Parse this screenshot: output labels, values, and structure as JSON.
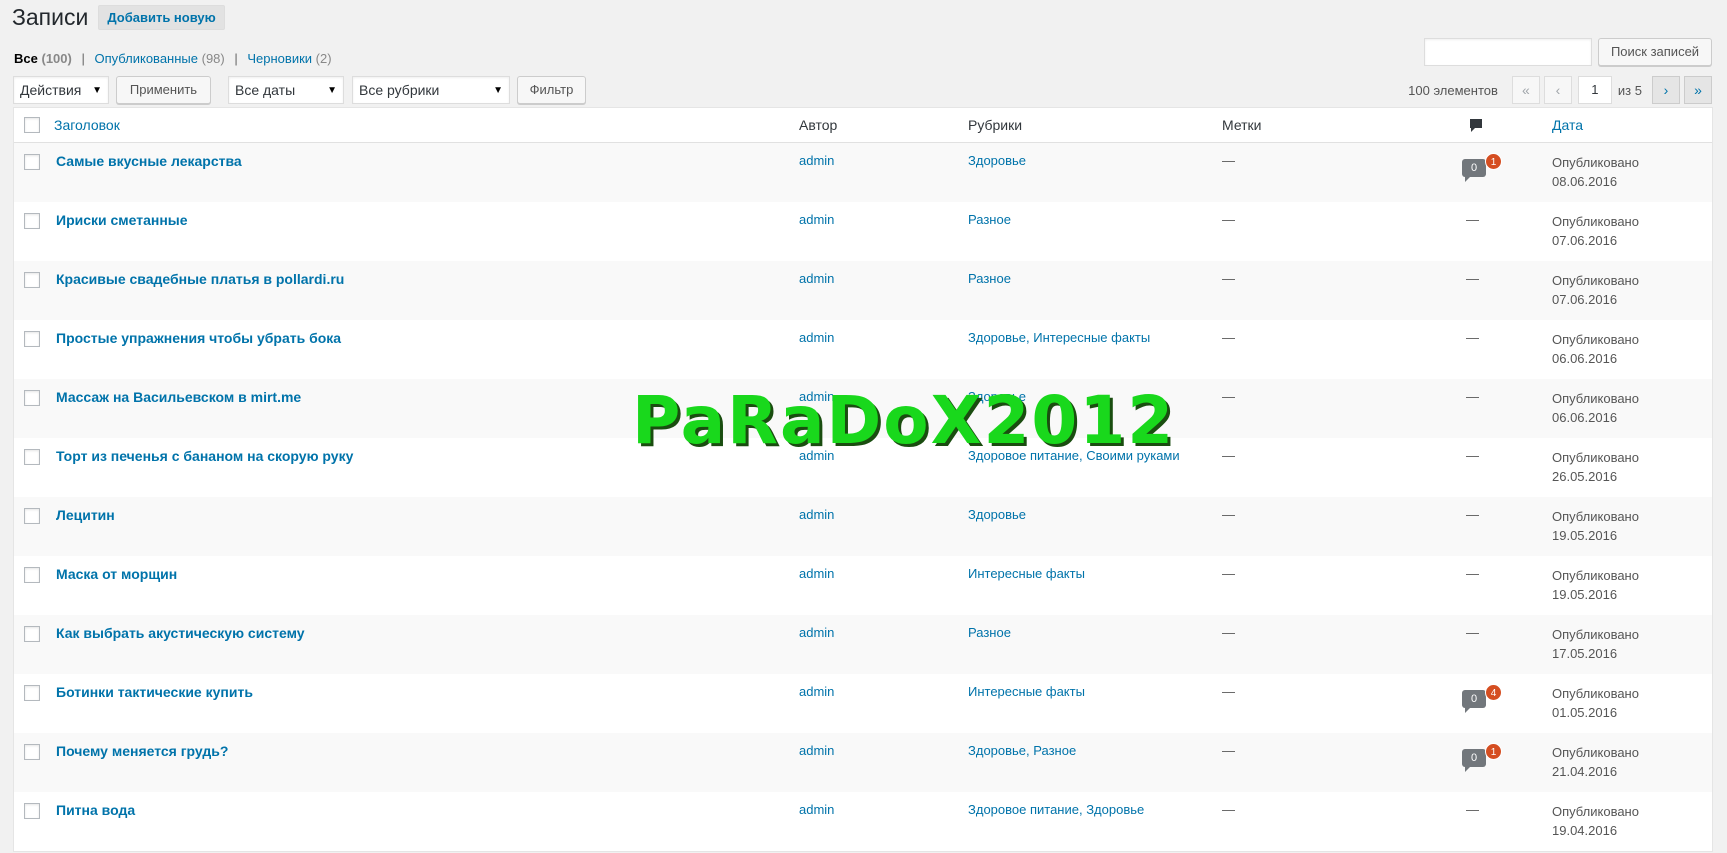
{
  "header": {
    "title": "Записи",
    "add_new": "Добавить новую"
  },
  "views": [
    {
      "label": "Все",
      "count": "(100)"
    },
    {
      "label": "Опубликованные",
      "count": "(98)"
    },
    {
      "label": "Черновики",
      "count": "(2)"
    }
  ],
  "separator": "|",
  "search": {
    "value": "",
    "button": "Поиск записей"
  },
  "tablenav": {
    "bulk_action": "Действия",
    "apply": "Применить",
    "dates": "Все даты",
    "categories": "Все рубрики",
    "filter": "Фильтр",
    "items_count": "100 элементов",
    "first": "«",
    "prev": "‹",
    "current_page": "1",
    "of_pages": "из 5",
    "next": "›",
    "last": "»"
  },
  "columns": {
    "title": "Заголовок",
    "author": "Автор",
    "categories": "Рубрики",
    "tags": "Метки",
    "date": "Дата"
  },
  "icons": {
    "comments_header": "comment-bubble-icon",
    "arrow": "▼"
  },
  "colors": {
    "link": "#0073aa",
    "pending": "#d54e21",
    "bubble": "#72777c",
    "watermark": "#19d81c"
  },
  "rows": [
    {
      "title": "Самые вкусные лекарства",
      "author": "admin",
      "categories": "Здоровье",
      "tags": "—",
      "comments": "0",
      "pending": "1",
      "status": "Опубликовано",
      "date": "08.06.2016"
    },
    {
      "title": "Ириски сметанные",
      "author": "admin",
      "categories": "Разное",
      "tags": "—",
      "comments": "—",
      "pending": "",
      "status": "Опубликовано",
      "date": "07.06.2016"
    },
    {
      "title": "Красивые свадебные платья в pollardi.ru",
      "author": "admin",
      "categories": "Разное",
      "tags": "—",
      "comments": "—",
      "pending": "",
      "status": "Опубликовано",
      "date": "07.06.2016"
    },
    {
      "title": "Простые упражнения чтобы убрать бока",
      "author": "admin",
      "categories": "Здоровье, Интересные факты",
      "tags": "—",
      "comments": "—",
      "pending": "",
      "status": "Опубликовано",
      "date": "06.06.2016"
    },
    {
      "title": "Массаж на Васильевском в mirt.me",
      "author": "admin",
      "categories": "Здоровье",
      "tags": "—",
      "comments": "—",
      "pending": "",
      "status": "Опубликовано",
      "date": "06.06.2016"
    },
    {
      "title": "Торт из печенья с бананом на скорую руку",
      "author": "admin",
      "categories": "Здоровое питание, Своими руками",
      "tags": "—",
      "comments": "—",
      "pending": "",
      "status": "Опубликовано",
      "date": "26.05.2016"
    },
    {
      "title": "Лецитин",
      "author": "admin",
      "categories": "Здоровье",
      "tags": "—",
      "comments": "—",
      "pending": "",
      "status": "Опубликовано",
      "date": "19.05.2016"
    },
    {
      "title": "Маска от морщин",
      "author": "admin",
      "categories": "Интересные факты",
      "tags": "—",
      "comments": "—",
      "pending": "",
      "status": "Опубликовано",
      "date": "19.05.2016"
    },
    {
      "title": "Как выбрать акустическую систему",
      "author": "admin",
      "categories": "Разное",
      "tags": "—",
      "comments": "—",
      "pending": "",
      "status": "Опубликовано",
      "date": "17.05.2016"
    },
    {
      "title": "Ботинки тактические купить",
      "author": "admin",
      "categories": "Интересные факты",
      "tags": "—",
      "comments": "0",
      "pending": "4",
      "status": "Опубликовано",
      "date": "01.05.2016"
    },
    {
      "title": "Почему меняется грудь?",
      "author": "admin",
      "categories": "Здоровье, Разное",
      "tags": "—",
      "comments": "0",
      "pending": "1",
      "status": "Опубликовано",
      "date": "21.04.2016"
    },
    {
      "title": "Питна вода",
      "author": "admin",
      "categories": "Здоровое питание, Здоровье",
      "tags": "—",
      "comments": "—",
      "pending": "",
      "status": "Опубликовано",
      "date": "19.04.2016"
    }
  ],
  "watermark": "PaRaDoX2012"
}
